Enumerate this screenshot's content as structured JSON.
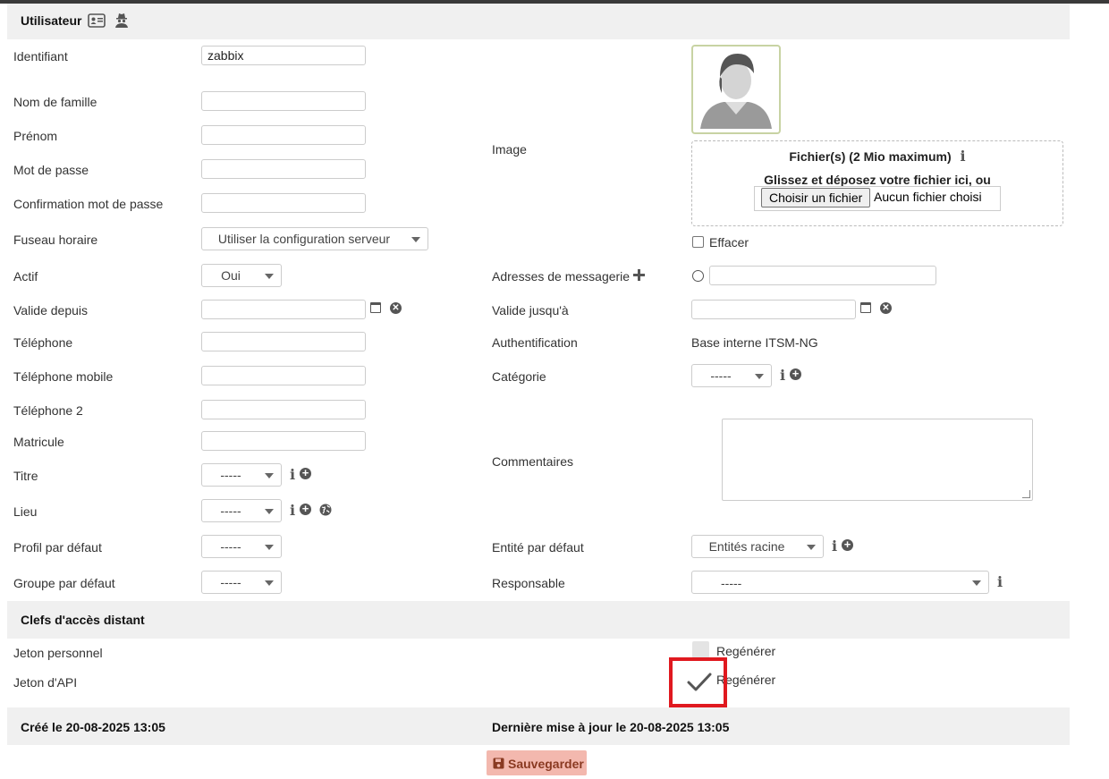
{
  "section_user": {
    "title": "Utilisateur",
    "icons": [
      "id-card-icon",
      "user-secret-icon"
    ]
  },
  "left_fields": {
    "identifiant": {
      "label": "Identifiant",
      "value": "zabbix"
    },
    "nom": {
      "label": "Nom de famille",
      "value": ""
    },
    "prenom": {
      "label": "Prénom",
      "value": ""
    },
    "mdp": {
      "label": "Mot de passe",
      "value": ""
    },
    "mdp_confirm": {
      "label": "Confirmation mot de passe",
      "value": ""
    },
    "fuseau": {
      "label": "Fuseau horaire",
      "value": "Utiliser la configuration serveur"
    },
    "actif": {
      "label": "Actif",
      "value": "Oui"
    },
    "valide_depuis": {
      "label": "Valide depuis",
      "value": ""
    },
    "telephone": {
      "label": "Téléphone",
      "value": ""
    },
    "tel_mobile": {
      "label": "Téléphone mobile",
      "value": ""
    },
    "tel2": {
      "label": "Téléphone 2",
      "value": ""
    },
    "matricule": {
      "label": "Matricule",
      "value": ""
    },
    "titre": {
      "label": "Titre",
      "value": "-----"
    },
    "lieu": {
      "label": "Lieu",
      "value": "-----"
    },
    "profil": {
      "label": "Profil par défaut",
      "value": "-----"
    },
    "groupe": {
      "label": "Groupe par défaut",
      "value": "-----"
    }
  },
  "right_fields": {
    "image": {
      "label": "Image"
    },
    "upload": {
      "title": "Fichier(s) (2 Mio maximum)",
      "drop_text": "Glissez et déposez votre fichier ici, ou",
      "button": "Choisir un fichier",
      "no_file": "Aucun fichier choisi"
    },
    "effacer": {
      "label": "Effacer",
      "checked": false
    },
    "emails": {
      "label": "Adresses de messagerie",
      "value": ""
    },
    "valide_jusqua": {
      "label": "Valide jusqu'à",
      "value": ""
    },
    "auth": {
      "label": "Authentification",
      "value": "Base interne ITSM-NG"
    },
    "categorie": {
      "label": "Catégorie",
      "value": "-----"
    },
    "commentaires": {
      "label": "Commentaires",
      "value": ""
    },
    "entite": {
      "label": "Entité par défaut",
      "value": "Entités racine"
    },
    "responsable": {
      "label": "Responsable",
      "value": "-----"
    }
  },
  "section_keys": {
    "title": "Clefs d'accès distant",
    "jeton_perso": {
      "label": "Jeton personnel",
      "action": "Regénérer",
      "checked": false
    },
    "jeton_api": {
      "label": "Jeton d'API",
      "action": "Regénérer",
      "checked": true
    }
  },
  "footer": {
    "created": "Créé le 20-08-2025 13:05",
    "updated": "Dernière mise à jour le 20-08-2025 13:05",
    "save": "Sauvegarder"
  },
  "colors": {
    "highlight": "#e0191f",
    "save_bg": "#f3b8ae",
    "save_text": "#8a3a22",
    "section_bg": "#f0f0f0"
  }
}
